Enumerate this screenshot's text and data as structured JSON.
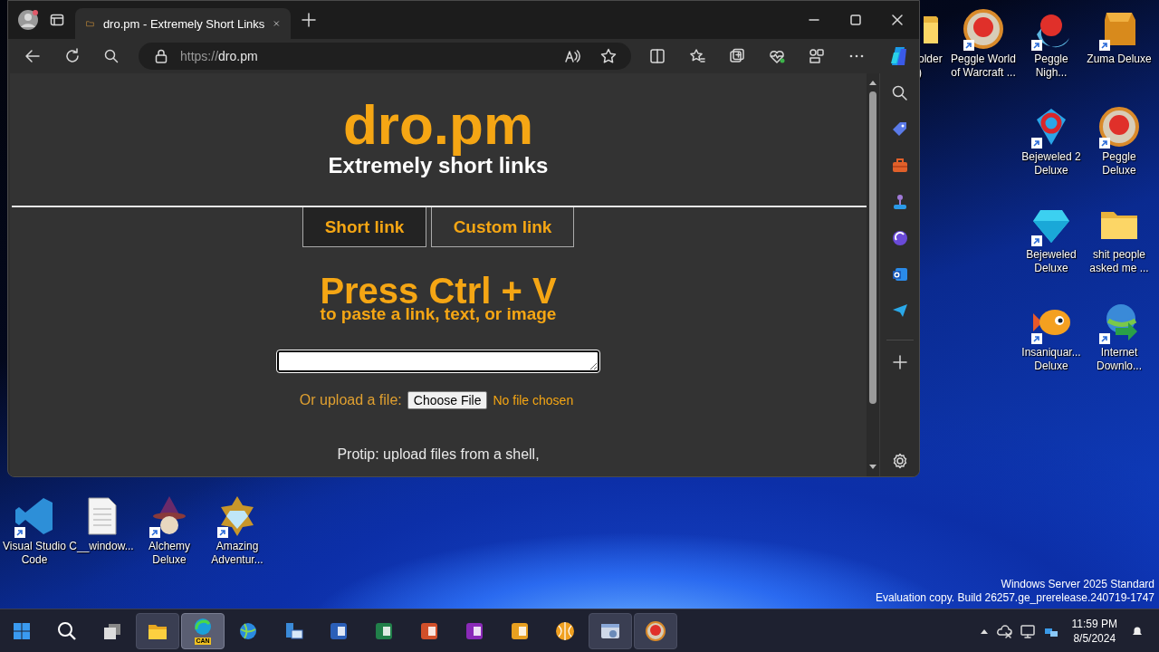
{
  "browser": {
    "tab": {
      "title": "dro.pm - Extremely Short Links",
      "selected": true
    },
    "address": {
      "scheme": "https://",
      "host": "dro.pm"
    }
  },
  "page": {
    "logo": "dro.pm",
    "tagline": "Extremely short links",
    "tabs": [
      {
        "label": "Short link",
        "selected": true
      },
      {
        "label": "Custom link",
        "selected": false
      }
    ],
    "heading": "Press Ctrl + V",
    "subheading": "to paste a link, text, or image",
    "upload": {
      "label": "Or upload a file:",
      "button": "Choose File",
      "status": "No file chosen"
    },
    "protip": "Protip: upload files from a shell,"
  },
  "desktop_icons": [
    {
      "kind": "folder",
      "label": "older\n)",
      "shortcut": false
    },
    {
      "kind": "ball",
      "label": "Peggle World\nof Warcraft ...",
      "shortcut": true
    },
    {
      "kind": "moon-ball",
      "label": "Peggle\nNigh...",
      "shortcut": true
    },
    {
      "kind": "block",
      "label": "Zuma Deluxe",
      "shortcut": true
    },
    {
      "kind": "gem",
      "label": "Bejeweled 2\nDeluxe",
      "shortcut": true
    },
    {
      "kind": "ball",
      "label": "Peggle\nDeluxe",
      "shortcut": true
    },
    {
      "kind": "diamond",
      "label": "Bejeweled\nDeluxe",
      "shortcut": true
    },
    {
      "kind": "folder",
      "label": "shit people\nasked me ...",
      "shortcut": false
    },
    {
      "kind": "fish",
      "label": "Insaniquar...\nDeluxe",
      "shortcut": true
    },
    {
      "kind": "globe",
      "label": "Internet\nDownlo...",
      "shortcut": true
    },
    {
      "kind": "ribbon",
      "label": "Visual Studio\nCode",
      "shortcut": true
    },
    {
      "kind": "document",
      "label": "C__window...",
      "shortcut": false
    },
    {
      "kind": "wizard",
      "label": "Alchemy\nDeluxe",
      "shortcut": true
    },
    {
      "kind": "framed-gem",
      "label": "Amazing\nAdventur...",
      "shortcut": true
    }
  ],
  "watermark": [
    "Windows Server 2025 Standard",
    "Evaluation copy. Build 26257.ge_prerelease.240719-1747"
  ],
  "taskbar": {
    "items": [
      {
        "kind": "start",
        "open": false,
        "selected": false
      },
      {
        "kind": "search",
        "open": false,
        "selected": false
      },
      {
        "kind": "taskview",
        "open": false,
        "selected": false
      },
      {
        "kind": "explorer",
        "open": true,
        "selected": false
      },
      {
        "kind": "edge",
        "open": true,
        "selected": true,
        "badge": "CAN"
      },
      {
        "kind": "network",
        "open": false,
        "selected": false
      },
      {
        "kind": "server",
        "open": false,
        "selected": false
      },
      {
        "kind": "word",
        "open": false,
        "selected": false
      },
      {
        "kind": "excel",
        "open": false,
        "selected": false
      },
      {
        "kind": "powerpoint",
        "open": false,
        "selected": false
      },
      {
        "kind": "onenote",
        "open": false,
        "selected": false
      },
      {
        "kind": "outlook",
        "open": false,
        "selected": false
      },
      {
        "kind": "orb",
        "open": false,
        "selected": false
      },
      {
        "kind": "window",
        "open": true,
        "selected": false
      },
      {
        "kind": "ball",
        "open": true,
        "selected": false
      }
    ],
    "time": "11:59 PM",
    "date": "8/5/2024"
  }
}
